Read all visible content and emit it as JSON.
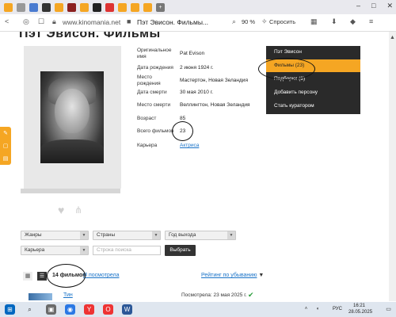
{
  "browser": {
    "url": "www.kinomania.net",
    "tab_title": "Пэт Эвисон. Фильмы...",
    "zoom": "90 %",
    "ask_label": "Спросить"
  },
  "page": {
    "title": "Пэт Эвисон. Фильмы"
  },
  "person": {
    "rows": [
      {
        "label": "Оригинальное имя",
        "value": "Pat Evison"
      },
      {
        "label": "Дата рождения",
        "value": "2 июня 1924 г."
      },
      {
        "label": "Место рождения",
        "value": "Мастертон, Новая Зеландия"
      },
      {
        "label": "Дата смерти",
        "value": "30 мая 2010 г."
      },
      {
        "label": "Место смерти",
        "value": "Веллингтон, Новая Зеландия"
      },
      {
        "label": "Возраст",
        "value": "85"
      },
      {
        "label": "Всего фильмов",
        "value": "23"
      },
      {
        "label": "Карьера",
        "value": "Актриса"
      }
    ]
  },
  "menu": {
    "items": [
      {
        "label": "Пэт Эвисон"
      },
      {
        "label": "Фильмы (23)"
      },
      {
        "label": "Подборки (8)"
      },
      {
        "label": "Добавить персону"
      },
      {
        "label": "Стать куратором"
      }
    ]
  },
  "filters": {
    "genres": "Жанры",
    "countries": "Страны",
    "year": "Год выхода",
    "career": "Карьера",
    "search_placeholder": "Строка поиска",
    "choose": "Выбрать"
  },
  "list": {
    "count": "14 фильмов",
    "watched": "Я посмотрела",
    "sort": "Рейтинг по убыванию",
    "film_title": "Тин",
    "watched_date": "Посмотрела: 23 мая 2025 г."
  },
  "taskbar": {
    "time": "16:21",
    "date": "28.05.2025",
    "lang": "РУС"
  }
}
